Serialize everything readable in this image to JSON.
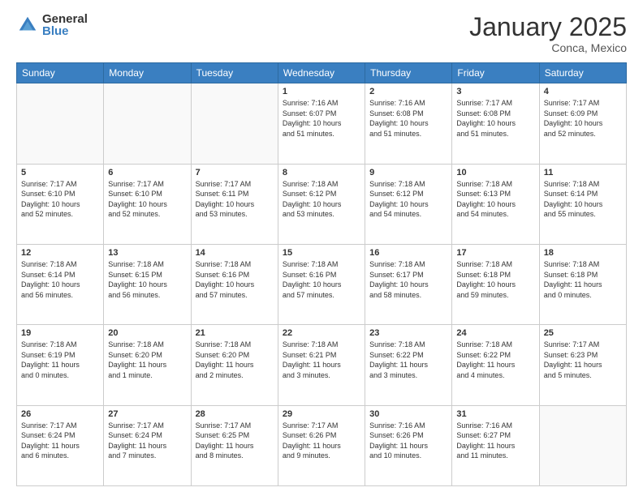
{
  "header": {
    "logo_general": "General",
    "logo_blue": "Blue",
    "month_title": "January 2025",
    "location": "Conca, Mexico"
  },
  "weekdays": [
    "Sunday",
    "Monday",
    "Tuesday",
    "Wednesday",
    "Thursday",
    "Friday",
    "Saturday"
  ],
  "weeks": [
    [
      {
        "day": "",
        "info": ""
      },
      {
        "day": "",
        "info": ""
      },
      {
        "day": "",
        "info": ""
      },
      {
        "day": "1",
        "info": "Sunrise: 7:16 AM\nSunset: 6:07 PM\nDaylight: 10 hours\nand 51 minutes."
      },
      {
        "day": "2",
        "info": "Sunrise: 7:16 AM\nSunset: 6:08 PM\nDaylight: 10 hours\nand 51 minutes."
      },
      {
        "day": "3",
        "info": "Sunrise: 7:17 AM\nSunset: 6:08 PM\nDaylight: 10 hours\nand 51 minutes."
      },
      {
        "day": "4",
        "info": "Sunrise: 7:17 AM\nSunset: 6:09 PM\nDaylight: 10 hours\nand 52 minutes."
      }
    ],
    [
      {
        "day": "5",
        "info": "Sunrise: 7:17 AM\nSunset: 6:10 PM\nDaylight: 10 hours\nand 52 minutes."
      },
      {
        "day": "6",
        "info": "Sunrise: 7:17 AM\nSunset: 6:10 PM\nDaylight: 10 hours\nand 52 minutes."
      },
      {
        "day": "7",
        "info": "Sunrise: 7:17 AM\nSunset: 6:11 PM\nDaylight: 10 hours\nand 53 minutes."
      },
      {
        "day": "8",
        "info": "Sunrise: 7:18 AM\nSunset: 6:12 PM\nDaylight: 10 hours\nand 53 minutes."
      },
      {
        "day": "9",
        "info": "Sunrise: 7:18 AM\nSunset: 6:12 PM\nDaylight: 10 hours\nand 54 minutes."
      },
      {
        "day": "10",
        "info": "Sunrise: 7:18 AM\nSunset: 6:13 PM\nDaylight: 10 hours\nand 54 minutes."
      },
      {
        "day": "11",
        "info": "Sunrise: 7:18 AM\nSunset: 6:14 PM\nDaylight: 10 hours\nand 55 minutes."
      }
    ],
    [
      {
        "day": "12",
        "info": "Sunrise: 7:18 AM\nSunset: 6:14 PM\nDaylight: 10 hours\nand 56 minutes."
      },
      {
        "day": "13",
        "info": "Sunrise: 7:18 AM\nSunset: 6:15 PM\nDaylight: 10 hours\nand 56 minutes."
      },
      {
        "day": "14",
        "info": "Sunrise: 7:18 AM\nSunset: 6:16 PM\nDaylight: 10 hours\nand 57 minutes."
      },
      {
        "day": "15",
        "info": "Sunrise: 7:18 AM\nSunset: 6:16 PM\nDaylight: 10 hours\nand 57 minutes."
      },
      {
        "day": "16",
        "info": "Sunrise: 7:18 AM\nSunset: 6:17 PM\nDaylight: 10 hours\nand 58 minutes."
      },
      {
        "day": "17",
        "info": "Sunrise: 7:18 AM\nSunset: 6:18 PM\nDaylight: 10 hours\nand 59 minutes."
      },
      {
        "day": "18",
        "info": "Sunrise: 7:18 AM\nSunset: 6:18 PM\nDaylight: 11 hours\nand 0 minutes."
      }
    ],
    [
      {
        "day": "19",
        "info": "Sunrise: 7:18 AM\nSunset: 6:19 PM\nDaylight: 11 hours\nand 0 minutes."
      },
      {
        "day": "20",
        "info": "Sunrise: 7:18 AM\nSunset: 6:20 PM\nDaylight: 11 hours\nand 1 minute."
      },
      {
        "day": "21",
        "info": "Sunrise: 7:18 AM\nSunset: 6:20 PM\nDaylight: 11 hours\nand 2 minutes."
      },
      {
        "day": "22",
        "info": "Sunrise: 7:18 AM\nSunset: 6:21 PM\nDaylight: 11 hours\nand 3 minutes."
      },
      {
        "day": "23",
        "info": "Sunrise: 7:18 AM\nSunset: 6:22 PM\nDaylight: 11 hours\nand 3 minutes."
      },
      {
        "day": "24",
        "info": "Sunrise: 7:18 AM\nSunset: 6:22 PM\nDaylight: 11 hours\nand 4 minutes."
      },
      {
        "day": "25",
        "info": "Sunrise: 7:17 AM\nSunset: 6:23 PM\nDaylight: 11 hours\nand 5 minutes."
      }
    ],
    [
      {
        "day": "26",
        "info": "Sunrise: 7:17 AM\nSunset: 6:24 PM\nDaylight: 11 hours\nand 6 minutes."
      },
      {
        "day": "27",
        "info": "Sunrise: 7:17 AM\nSunset: 6:24 PM\nDaylight: 11 hours\nand 7 minutes."
      },
      {
        "day": "28",
        "info": "Sunrise: 7:17 AM\nSunset: 6:25 PM\nDaylight: 11 hours\nand 8 minutes."
      },
      {
        "day": "29",
        "info": "Sunrise: 7:17 AM\nSunset: 6:26 PM\nDaylight: 11 hours\nand 9 minutes."
      },
      {
        "day": "30",
        "info": "Sunrise: 7:16 AM\nSunset: 6:26 PM\nDaylight: 11 hours\nand 10 minutes."
      },
      {
        "day": "31",
        "info": "Sunrise: 7:16 AM\nSunset: 6:27 PM\nDaylight: 11 hours\nand 11 minutes."
      },
      {
        "day": "",
        "info": ""
      }
    ]
  ]
}
